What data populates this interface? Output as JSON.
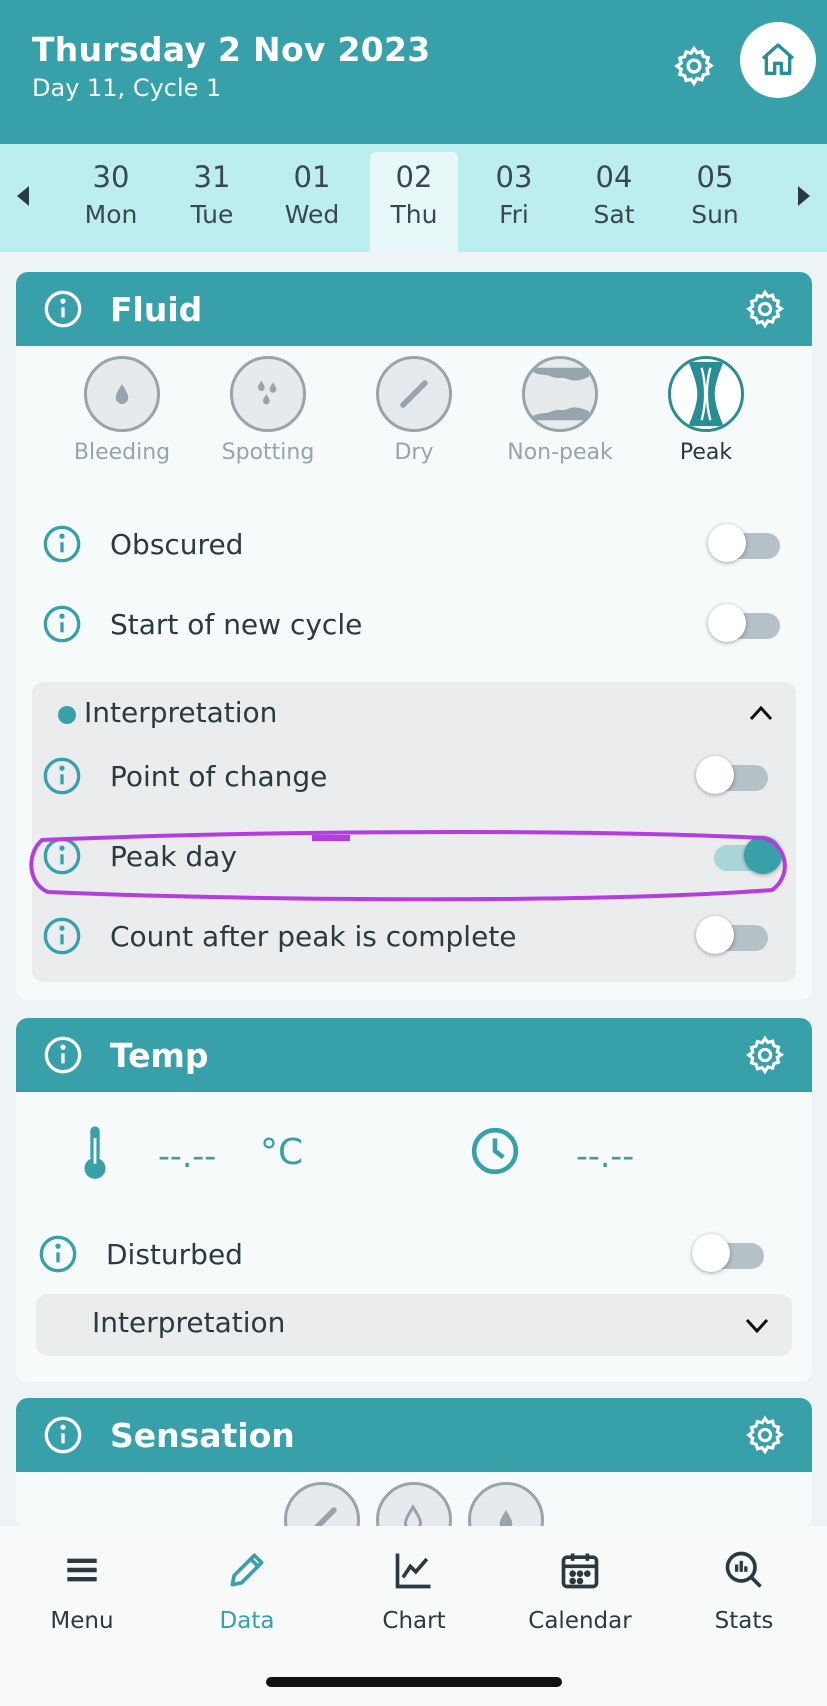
{
  "header": {
    "title": "Thursday 2 Nov 2023",
    "subtitle": "Day 11, Cycle 1"
  },
  "days": [
    {
      "num": "30",
      "name": "Mon",
      "selected": false
    },
    {
      "num": "31",
      "name": "Tue",
      "selected": false
    },
    {
      "num": "01",
      "name": "Wed",
      "selected": false
    },
    {
      "num": "02",
      "name": "Thu",
      "selected": true
    },
    {
      "num": "03",
      "name": "Fri",
      "selected": false
    },
    {
      "num": "04",
      "name": "Sat",
      "selected": false
    },
    {
      "num": "05",
      "name": "Sun",
      "selected": false
    }
  ],
  "fluid": {
    "title": "Fluid",
    "options": [
      {
        "label": "Bleeding",
        "icon": "drop-icon",
        "active": false
      },
      {
        "label": "Spotting",
        "icon": "spots-icon",
        "active": false
      },
      {
        "label": "Dry",
        "icon": "slash-icon",
        "active": false
      },
      {
        "label": "Non-peak",
        "icon": "nonpeak-icon",
        "active": false
      },
      {
        "label": "Peak",
        "icon": "peak-icon",
        "active": true
      }
    ],
    "obscured": {
      "label": "Obscured",
      "on": false
    },
    "new_cycle": {
      "label": "Start of new cycle",
      "on": false
    },
    "interpretation": {
      "label": "Interpretation",
      "point_of_change": {
        "label": "Point of change",
        "on": false
      },
      "peak_day": {
        "label": "Peak day",
        "on": true
      },
      "count_after_peak": {
        "label": "Count after peak is complete",
        "on": false
      }
    }
  },
  "temp": {
    "title": "Temp",
    "value": "--.--",
    "unit": "°C",
    "time": "--.--",
    "disturbed": {
      "label": "Disturbed",
      "on": false
    },
    "interpretation_label": "Interpretation"
  },
  "sensation": {
    "title": "Sensation"
  },
  "nav": {
    "items": [
      {
        "label": "Menu",
        "active": false
      },
      {
        "label": "Data",
        "active": true
      },
      {
        "label": "Chart",
        "active": false
      },
      {
        "label": "Calendar",
        "active": false
      },
      {
        "label": "Stats",
        "active": false
      }
    ]
  },
  "colors": {
    "teal": "#37a0a8",
    "highlight": "#b43de0"
  }
}
